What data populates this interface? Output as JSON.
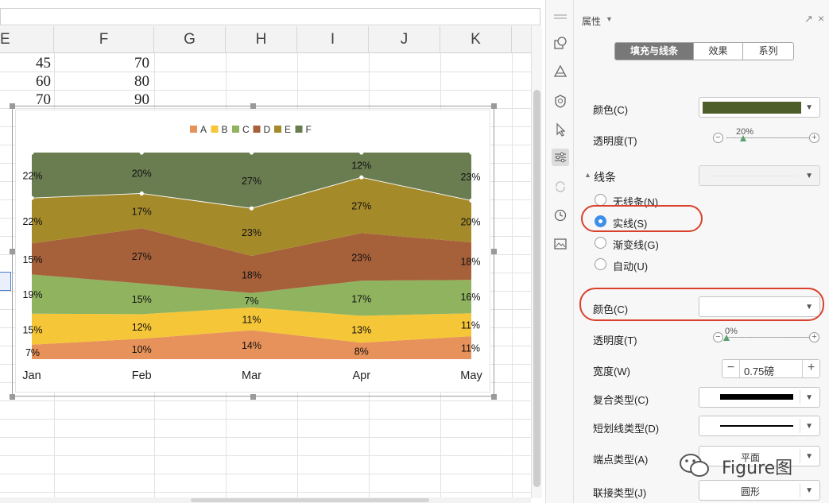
{
  "sheet": {
    "columns": [
      "E",
      "F",
      "G",
      "H",
      "I",
      "J",
      "K"
    ],
    "rows": [
      {
        "e": "45",
        "f": "70"
      },
      {
        "e": "60",
        "f": "80"
      },
      {
        "e": "70",
        "f": "90"
      }
    ]
  },
  "chart_data": {
    "type": "area",
    "stacked": "percent",
    "categories": [
      "Jan",
      "Feb",
      "Mar",
      "Apr",
      "May"
    ],
    "series": [
      {
        "name": "A",
        "color": "#e6925a",
        "values": [
          7,
          10,
          14,
          8,
          11
        ],
        "labels": [
          "7%",
          "10%",
          "14%",
          "8%",
          "11%"
        ]
      },
      {
        "name": "B",
        "color": "#f5c637",
        "values": [
          15,
          12,
          11,
          13,
          11
        ],
        "labels": [
          "15%",
          "12%",
          "11%",
          "13%",
          "11%"
        ]
      },
      {
        "name": "C",
        "color": "#8fb35f",
        "values": [
          19,
          15,
          7,
          17,
          16
        ],
        "labels": [
          "19%",
          "15%",
          "7%",
          "17%",
          "16%"
        ]
      },
      {
        "name": "D",
        "color": "#a6603a",
        "values": [
          15,
          27,
          18,
          23,
          18
        ],
        "labels": [
          "15%",
          "27%",
          "18%",
          "23%",
          "18%"
        ]
      },
      {
        "name": "E",
        "color": "#a58a2a",
        "values": [
          22,
          17,
          23,
          27,
          20
        ],
        "labels": [
          "22%",
          "17%",
          "23%",
          "27%",
          "20%"
        ]
      },
      {
        "name": "F",
        "color": "#6a7d50",
        "values": [
          22,
          20,
          27,
          12,
          23
        ],
        "labels": [
          "22%",
          "20%",
          "27%",
          "12%",
          "23%"
        ]
      }
    ],
    "legend_position": "top",
    "grid": false,
    "title": ""
  },
  "panel": {
    "title": "属性",
    "tabs": [
      {
        "label": "填充与线条",
        "active": true
      },
      {
        "label": "效果",
        "active": false
      },
      {
        "label": "系列",
        "active": false
      }
    ],
    "fill": {
      "color_label": "颜色(C)",
      "color_value": "#4e5e2a",
      "transparency_label": "透明度(T)",
      "transparency_value": "20%",
      "transparency_fraction": 0.2
    },
    "line": {
      "section_label": "线条",
      "options": [
        {
          "label": "无线条(N)",
          "selected": false
        },
        {
          "label": "实线(S)",
          "selected": true
        },
        {
          "label": "渐变线(G)",
          "selected": false
        },
        {
          "label": "自动(U)",
          "selected": false
        }
      ],
      "color_label": "颜色(C)",
      "color_value": "#ffffff",
      "transparency_label": "透明度(T)",
      "transparency_value": "0%",
      "transparency_fraction": 0.0,
      "width_label": "宽度(W)",
      "width_value": "0.75磅",
      "compound_label": "复合类型(C)",
      "dash_label": "短划线类型(D)",
      "cap_label": "端点类型(A)",
      "cap_value": "平面",
      "join_label": "联接类型(J)",
      "join_value": "圆形"
    }
  },
  "watermark": {
    "text": "Figure图"
  }
}
